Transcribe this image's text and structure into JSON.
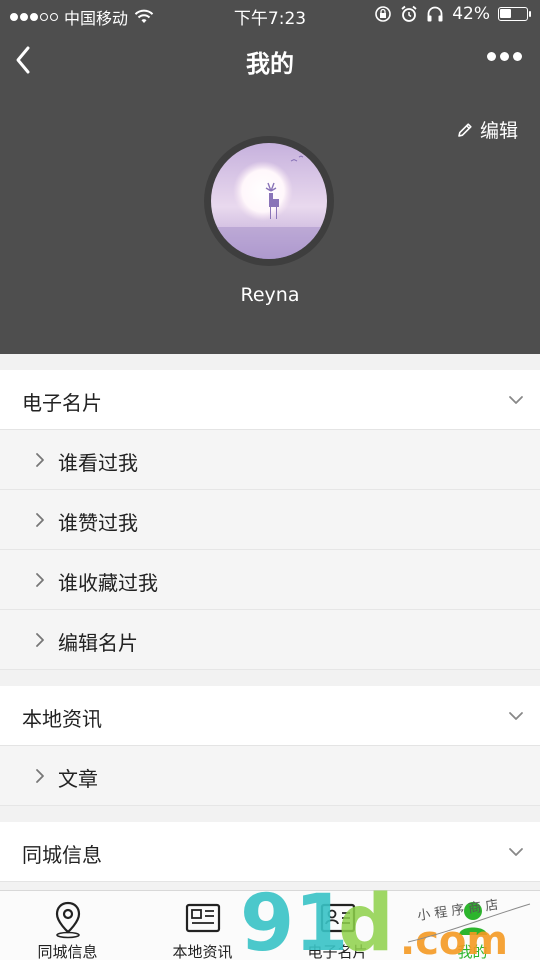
{
  "status_bar": {
    "carrier": "中国移动",
    "time": "下午7:23",
    "battery": "42%",
    "battery_level": 0.42
  },
  "nav": {
    "title": "我的"
  },
  "profile": {
    "edit_label": "编辑",
    "username": "Reyna"
  },
  "sections": [
    {
      "title": "电子名片",
      "items": [
        "谁看过我",
        "谁赞过我",
        "谁收藏过我",
        "编辑名片"
      ]
    },
    {
      "title": "本地资讯",
      "items": [
        "文章"
      ]
    },
    {
      "title": "同城信息",
      "items": []
    }
  ],
  "tabbar": {
    "tabs": [
      {
        "label": "同城信息",
        "icon": "location-pin-icon"
      },
      {
        "label": "本地资讯",
        "icon": "newspaper-icon"
      },
      {
        "label": "电子名片",
        "icon": "business-card-icon"
      },
      {
        "label": "我的",
        "icon": "user-icon",
        "active": true
      }
    ]
  },
  "watermark": {
    "number": "91",
    "letters": "d",
    "domain": ".com",
    "tagline": "小 程 序 商 店"
  },
  "colors": {
    "header_bg": "#4e4e4e",
    "active_tab": "#2db52d",
    "watermark_teal": "#39c3c6",
    "watermark_green": "#8ed14a",
    "watermark_orange": "#f59a23"
  }
}
